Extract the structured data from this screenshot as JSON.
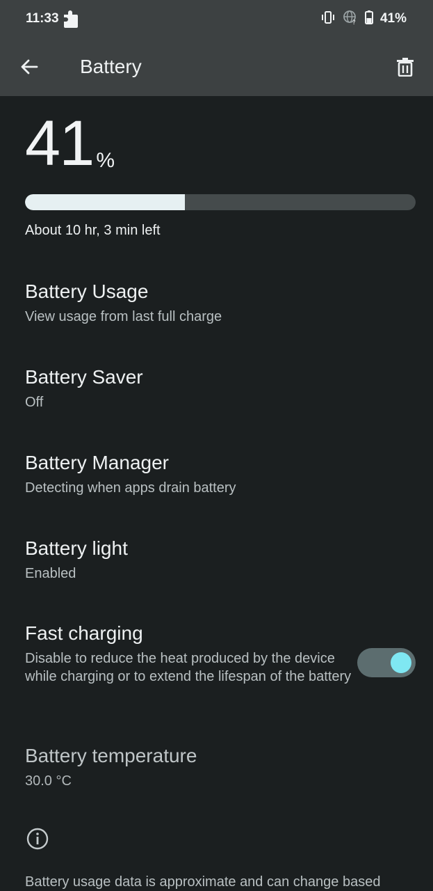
{
  "status_bar": {
    "time": "11:33",
    "battery_text": "41%",
    "icons": [
      "notification-puzzle-icon",
      "vibrate-icon",
      "network-unknown-icon",
      "battery-icon"
    ]
  },
  "app_bar": {
    "title": "Battery",
    "back_icon": "arrow-left-icon",
    "action_icon": "trash-icon"
  },
  "battery_level": {
    "number": "41",
    "unit": "%",
    "fraction": 0.41,
    "time_left": "About 10 hr, 3 min left"
  },
  "preferences": [
    {
      "title": "Battery Usage",
      "summary": "View usage from last full charge"
    },
    {
      "title": "Battery Saver",
      "summary": "Off"
    },
    {
      "title": "Battery Manager",
      "summary": "Detecting when apps drain battery"
    },
    {
      "title": "Battery light",
      "summary": "Enabled"
    },
    {
      "title": "Fast charging",
      "summary": "Disable to reduce the heat produced by the device while charging or to extend the lifespan of the battery",
      "toggle_on": true
    },
    {
      "title": "Battery temperature",
      "summary": "30.0 °C"
    }
  ],
  "footer": {
    "icon": "info-icon",
    "text": "Battery usage data is approximate and can change based"
  },
  "colors": {
    "background": "#1b1f20",
    "header": "#3d4142",
    "accent": "#7fe7f2",
    "bar_fill": "#e6f0f2",
    "bar_track": "#454b4c"
  }
}
